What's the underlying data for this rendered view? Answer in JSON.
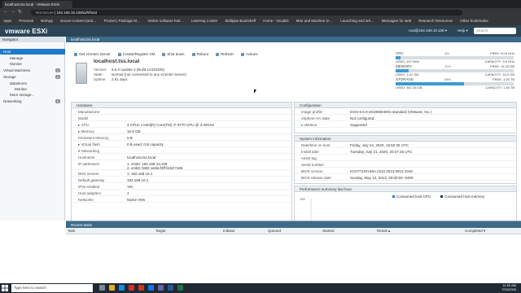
{
  "browser": {
    "tab_title": "localhost.tss.local - VMware ESXi",
    "security": "Not secure",
    "url": "192.168.10.108/ui/#/host",
    "bookmarks": [
      "Apps",
      "Personal",
      "NetApp",
      "secure-content-{anti…",
      "ProGet | Package M…",
      "Online software hub…",
      "Learning Locker",
      "Skillpipe Bookshelf",
      "Home - VocalID",
      "Man and Machine (e…",
      "Launching and arti…",
      "Messages for web",
      "Research Resources",
      "Other bookmarks"
    ]
  },
  "esxi": {
    "brand": "vmware ESXi",
    "user": "root@192.168.10.108 ▾",
    "help": "Help ▾",
    "search_placeholder": "Search"
  },
  "navigator": {
    "title": "Navigator",
    "items": [
      {
        "label": "Host",
        "active": true
      },
      {
        "label": "Manage"
      },
      {
        "label": "Monitor"
      },
      {
        "label": "Virtual Machines",
        "count": "1"
      },
      {
        "label": "Storage",
        "count": "1"
      },
      {
        "label": "datastore1"
      },
      {
        "label": "Monitor"
      },
      {
        "label": "More storage..."
      },
      {
        "label": "Networking",
        "count": "1"
      }
    ]
  },
  "breadcrumb": "localhost.tss.local",
  "toolbar": [
    "Get vCenter Server",
    "Create/Register VM",
    "Shut down",
    "Reboot",
    "Refresh",
    "Actions"
  ],
  "host": {
    "name": "localhost.tss.local",
    "version_label": "Version:",
    "version": "6.5.0 Update 3 (Build 14320405)",
    "state_label": "State:",
    "state": "Normal (not connected to any vCenter Server)",
    "uptime_label": "Uptime:",
    "uptime": "2.81 days"
  },
  "resources": [
    {
      "label": "CPU",
      "free": "FREE: 9.04 GHz",
      "pct": "4%",
      "used": "USED: 407 MHz",
      "cap": "CAPACITY: 9.6 GHz",
      "fill": 0.04
    },
    {
      "label": "MEMORY",
      "free": "FREE: 14.23 GB",
      "pct": "11%",
      "used": "USED: 1.67 GB",
      "cap": "CAPACITY: 15.9 GB",
      "fill": 0.11
    },
    {
      "label": "STORAGE",
      "free": "FREE: 1.00 TB",
      "pct": "58%",
      "used": "USED: 467.26 GB",
      "cap": "CAPACITY: 1.46 TB",
      "fill": 0.58
    }
  ],
  "hardware": {
    "title": "Hardware",
    "rows": [
      {
        "k": "Manufacturer",
        "v": ""
      },
      {
        "k": "Model",
        "v": ""
      },
      {
        "k": "▸ CPU",
        "v": "4 CPUs x Intel(R) Core(TM) i7-3770 CPU @ 3.40GHz"
      },
      {
        "k": "▸ Memory",
        "v": "15.9 GB"
      },
      {
        "k": "Persistent Memory",
        "v": "0 B"
      },
      {
        "k": "▸ Virtual flash",
        "v": "0 B used, 0 B capacity"
      },
      {
        "k": "▾ Networking",
        "v": ""
      },
      {
        "k": "Hostname",
        "v": "localhost.tss.local"
      },
      {
        "k": "IP addresses",
        "v": "1. vmk0: 192.168.10.108\n2. vmk0: fe80::ee9a:f3ff:fe3d:7165",
        "tall": true
      },
      {
        "k": "DNS servers",
        "v": "1. 192.168.10.1"
      },
      {
        "k": "Default gateway",
        "v": "192.168.10.1"
      },
      {
        "k": "IPv6 enabled",
        "v": "Yes"
      },
      {
        "k": "Host adapters",
        "v": "1"
      },
      {
        "k": "Networks",
        "v": "Name                                              VMs"
      }
    ]
  },
  "configuration": {
    "title": "Configuration",
    "rows": [
      {
        "k": "Image profile",
        "v": "ESXi-6.5.0-20190604001-standard (VMware, Inc.)"
      },
      {
        "k": "vSphere HA state",
        "v": "Not configured"
      },
      {
        "k": "▸ vMotion",
        "v": "Supported"
      }
    ]
  },
  "system_info": {
    "title": "System information",
    "rows": [
      {
        "k": "Date/time on host",
        "v": "Friday, July 24, 2020, 15:52:25 UTC"
      },
      {
        "k": "Install date",
        "v": "Tuesday, July 21, 2020, 20:27:25 UTC"
      },
      {
        "k": "Asset tag",
        "v": ""
      },
      {
        "k": "Serial number",
        "v": ""
      },
      {
        "k": "BIOS version",
        "v": "KCH7710H.86A.0110.2013.0513.1018"
      },
      {
        "k": "BIOS release date",
        "v": "Sunday, May 12, 2013, 20:00:00 -0400"
      }
    ]
  },
  "performance": {
    "title": "Performance summary last hour",
    "legend": [
      "Consumed host CPU",
      "Consumed host memory"
    ],
    "legend_colors": [
      "#2f7ec6",
      "#1b3a6b"
    ],
    "ytick": "100"
  },
  "recent_tasks": {
    "title": "Recent tasks",
    "columns": [
      "Task",
      "Target",
      "Initiator",
      "Queued",
      "Started",
      "Result ▴",
      "Completed ▾"
    ]
  },
  "taskbar": {
    "search": "Type here to search",
    "time": "11:52 AM",
    "date": "7/24/2020"
  }
}
